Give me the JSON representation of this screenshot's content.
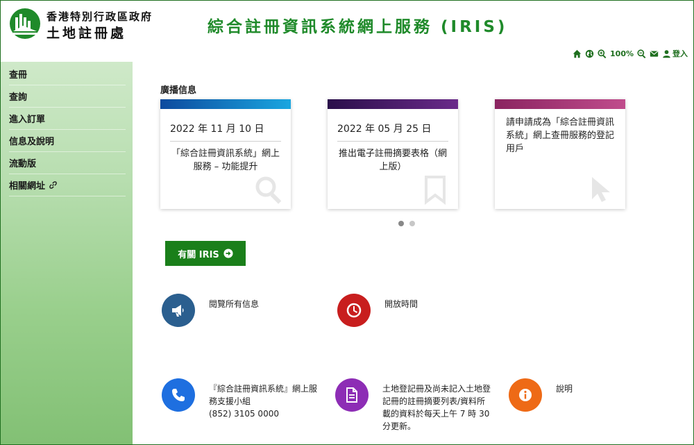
{
  "header": {
    "org_line1": "香港特別行政區政府",
    "org_line2": "土地註冊處",
    "site_title": "綜合註冊資訊系統網上服務 (IRIS)"
  },
  "toolbar": {
    "zoom_level": "100%",
    "login_label": "登入"
  },
  "sidebar": {
    "items": [
      {
        "label": "查冊"
      },
      {
        "label": "查詢"
      },
      {
        "label": "進入訂單"
      },
      {
        "label": "信息及說明"
      },
      {
        "label": "流動版"
      },
      {
        "label": "相關網址"
      }
    ]
  },
  "broadcast": {
    "title": "廣播信息",
    "cards": [
      {
        "date": "2022 年 11 月 10 日",
        "text": "「綜合註冊資訊系統」網上服務 – 功能提升",
        "bar_color": "#1aa6e0"
      },
      {
        "date": "2022 年 05 月 25 日",
        "text": "推出電子註冊摘要表格（網上版）",
        "bar_color": "#3a1d6b"
      },
      {
        "text": "請申請成為「綜合註冊資訊系統」網上查冊服務的登記用戶",
        "bar_color": "#9c2d73"
      }
    ]
  },
  "about_button": {
    "label": "有關 IRIS"
  },
  "quick_links": [
    {
      "label": "閱覽所有信息",
      "color": "#2b5f8f"
    },
    {
      "label": "開放時間",
      "color": "#c81e1e"
    },
    {
      "label": "『綜合註冊資訊系統』網上服\n務支援小組\n(852) 3105 0000",
      "color": "#1e6fe0"
    },
    {
      "label": "土地登記冊及尚未記入土地登\n記冊的註冊摘要列表/資料所\n載的資料於每天上午 7 時 30\n分更新。",
      "color": "#8d2db5"
    },
    {
      "label": "說明",
      "color": "#ee6a16"
    }
  ],
  "colors": {
    "brand_green": "#1f8a2a",
    "button_green": "#1a7f1a"
  }
}
